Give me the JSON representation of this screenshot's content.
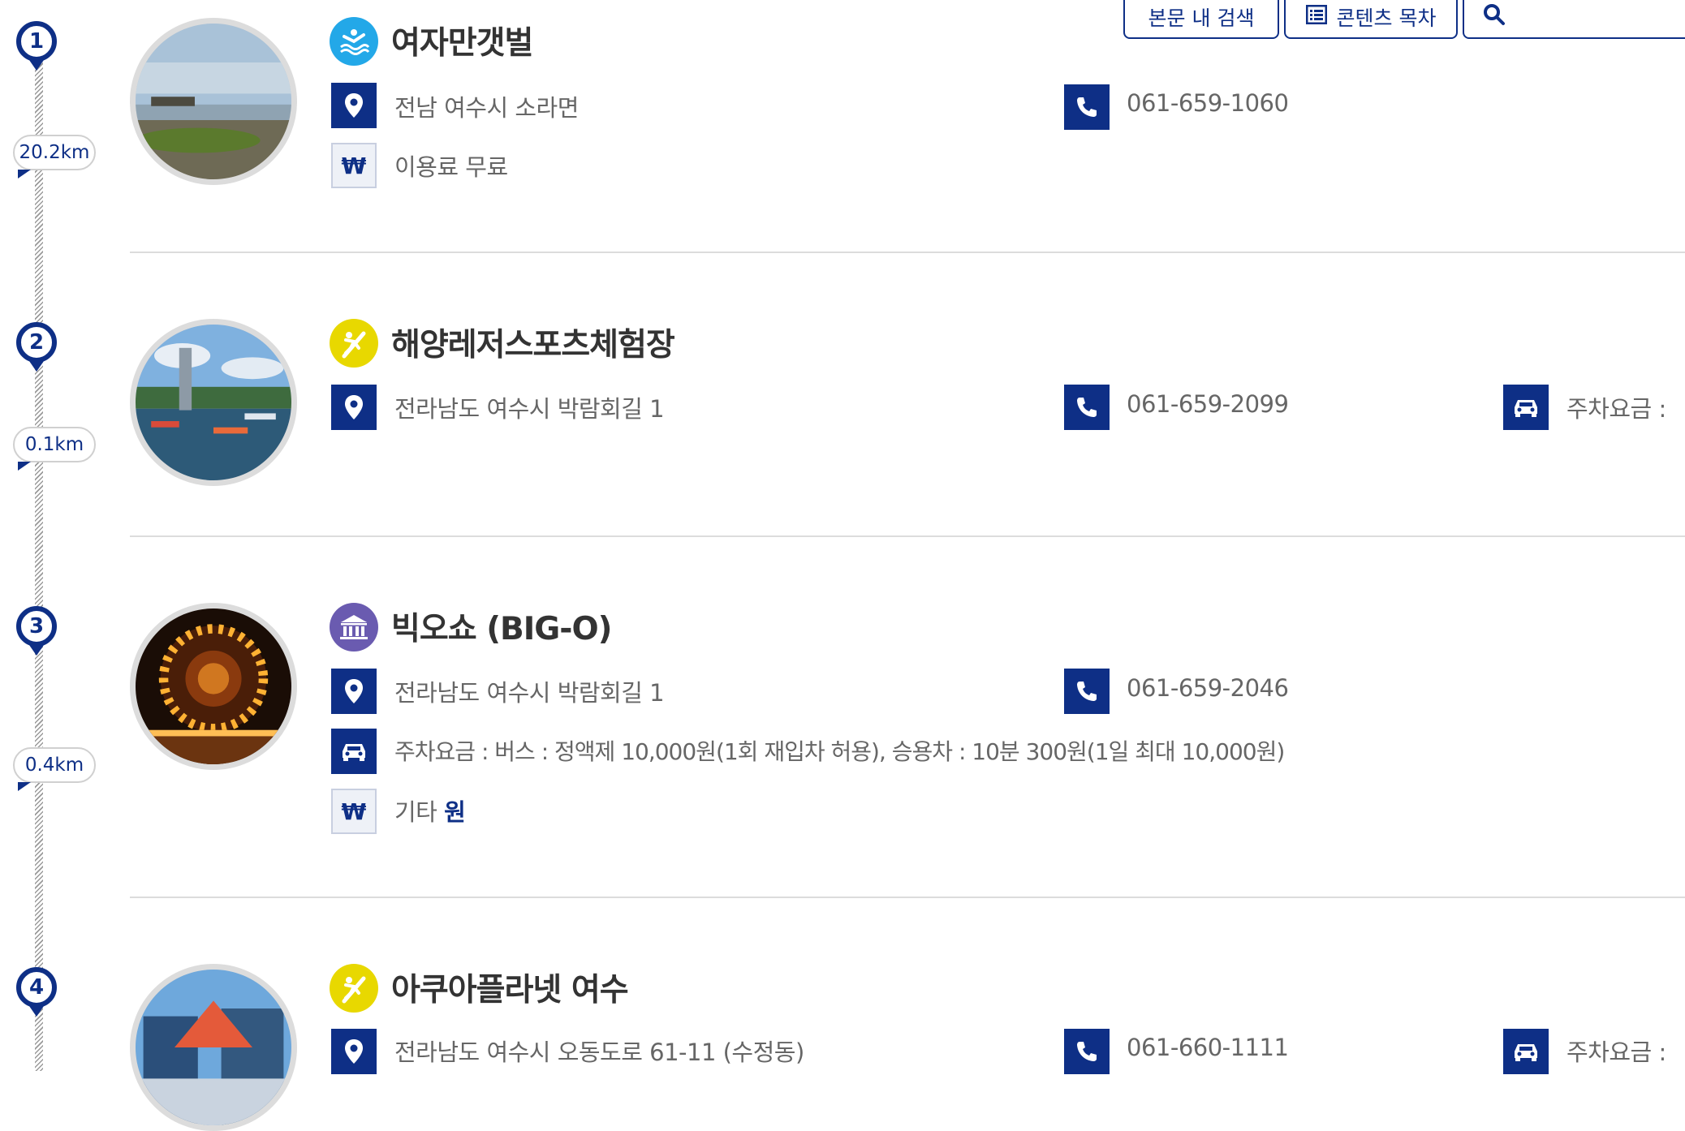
{
  "toolbar": {
    "search_in_content_label": "본문 내 검색",
    "table_of_contents_label": "콘텐츠 목차",
    "search_icon": "magnifier-icon"
  },
  "colors": {
    "accent": "#0e2f86",
    "leisure": "#e8d800",
    "water": "#23a8e8",
    "culture": "#6a5bb0",
    "divider": "#dcdcdc"
  },
  "places": [
    {
      "step": "1",
      "title": "여자만갯벌",
      "category_icon": "swimmer-icon",
      "address": "전남 여수시 소라면",
      "phone": "061-659-1060",
      "fee": "이용료 무료",
      "distance_to_next": "20.2km"
    },
    {
      "step": "2",
      "title": "해양레저스포츠체험장",
      "category_icon": "surfing-icon",
      "address": "전라남도 여수시 박람회길 1",
      "phone": "061-659-2099",
      "parking": "주차요금 :",
      "distance_to_next": "0.1km"
    },
    {
      "step": "3",
      "title": "빅오쇼 (BIG-O)",
      "category_icon": "museum-icon",
      "address": "전라남도 여수시 박람회길 1",
      "phone": "061-659-2046",
      "parking": "주차요금 : 버스 : 정액제 10,000원(1회 재입차 허용), 승용차 : 10분 300원(1일 최대 10,000원)",
      "fee_prefix": "기타",
      "fee_value": "원",
      "distance_to_next": "0.4km"
    },
    {
      "step": "4",
      "title": "아쿠아플라넷 여수",
      "category_icon": "surfing-icon",
      "address": "전라남도 여수시 오동도로 61-11 (수정동)",
      "phone": "061-660-1111",
      "parking": "주차요금 :"
    }
  ]
}
